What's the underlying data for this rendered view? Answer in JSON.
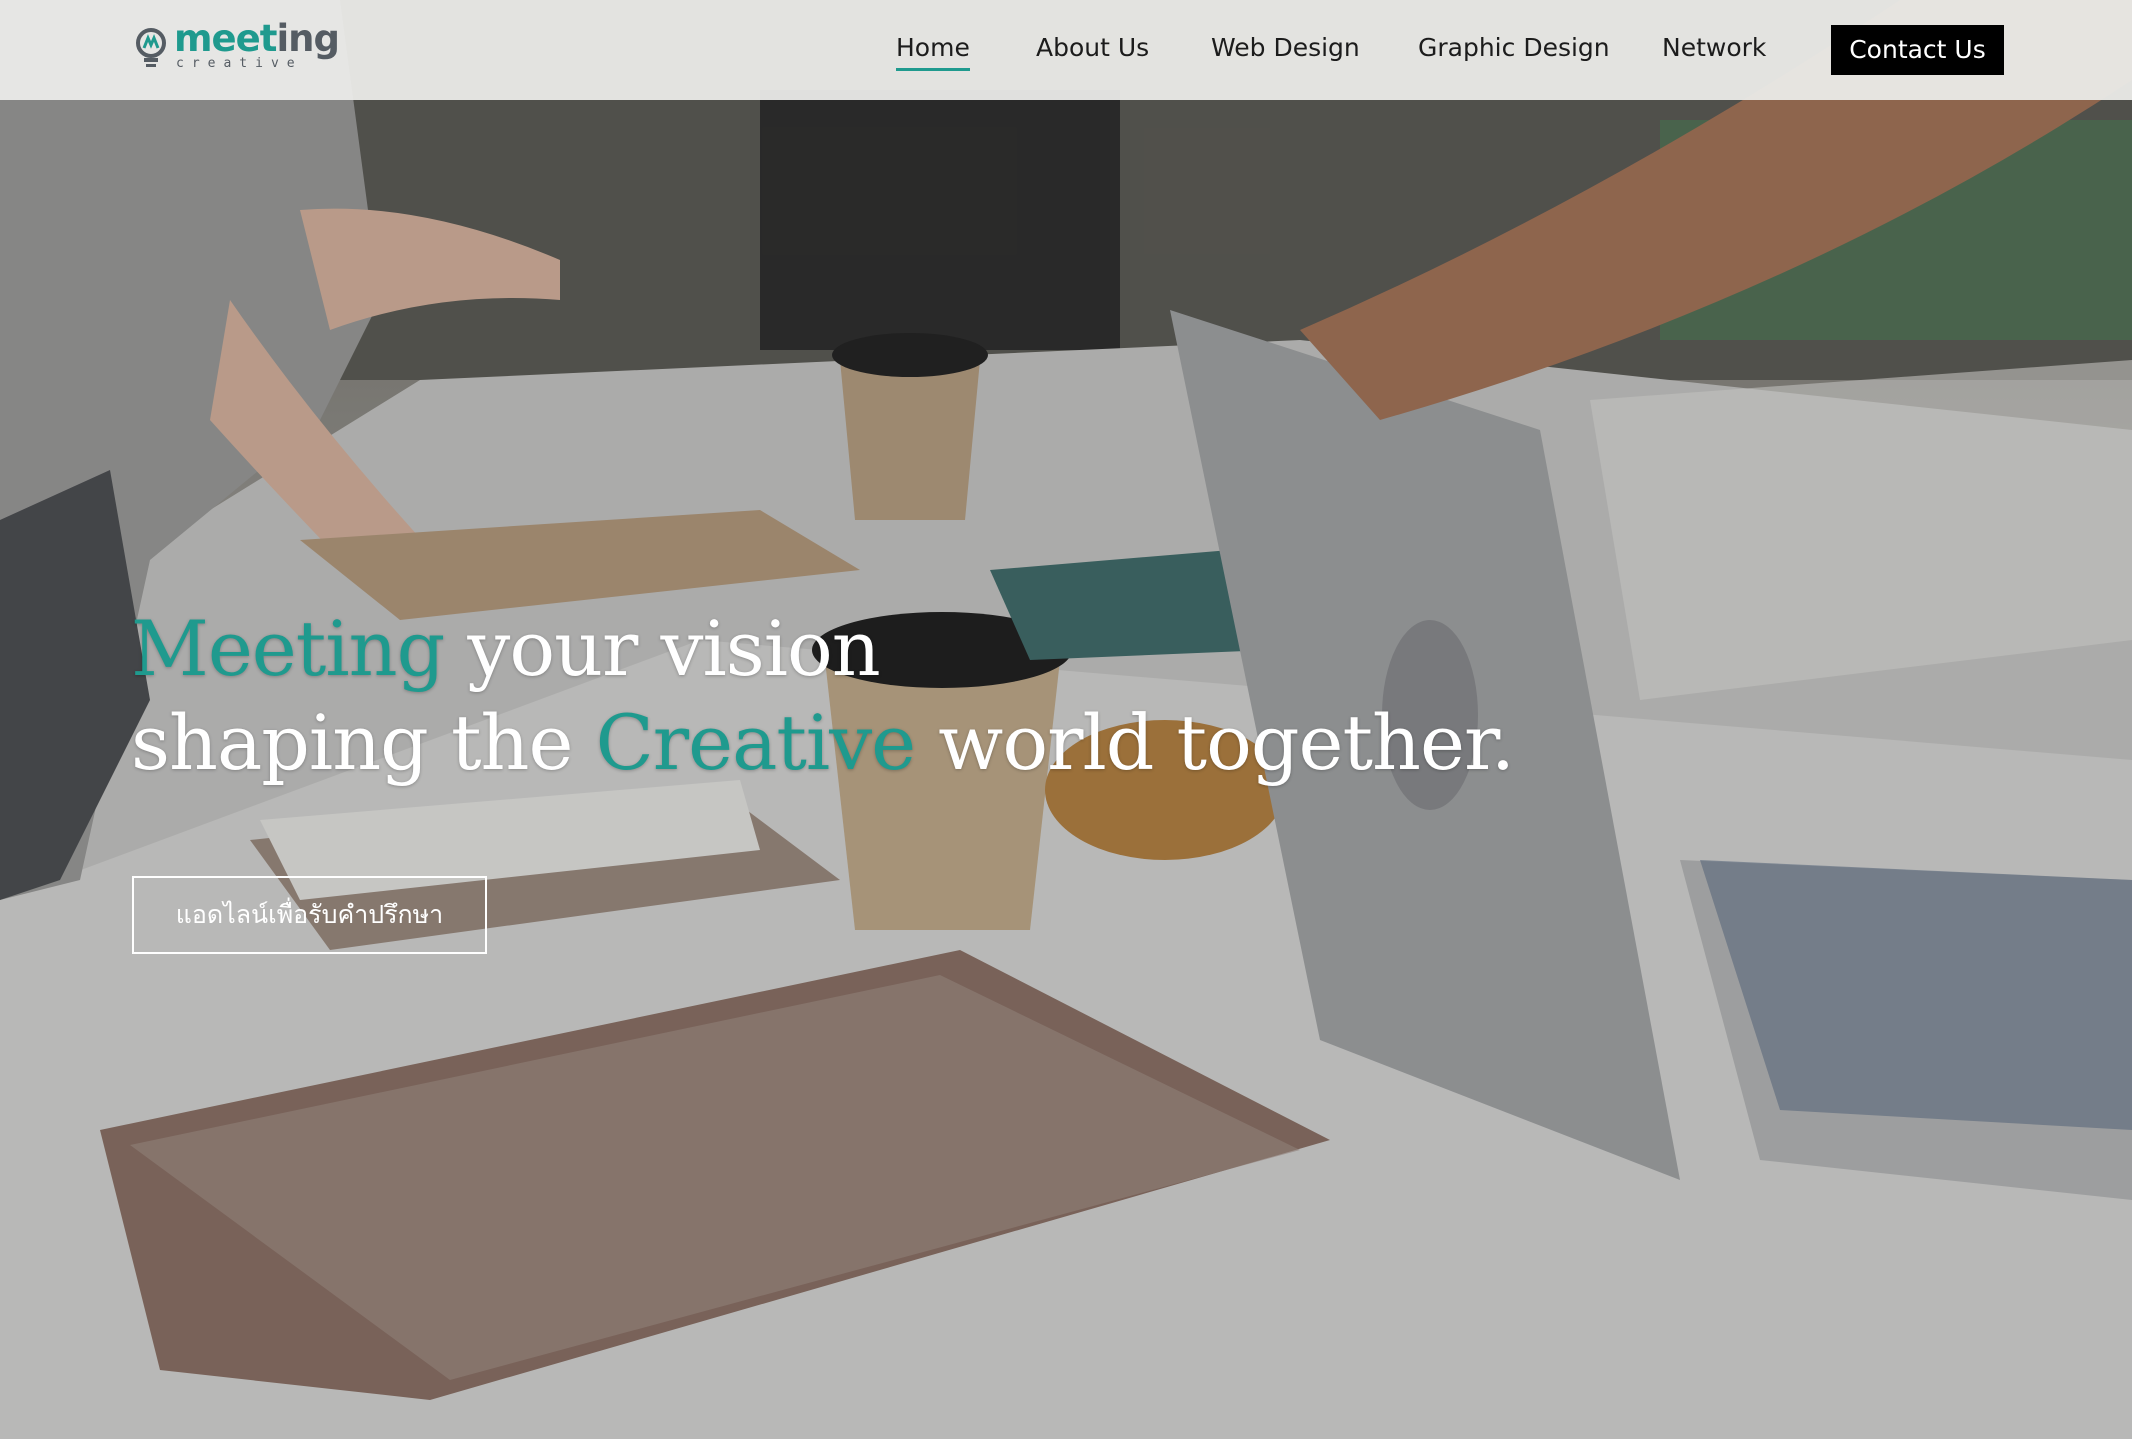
{
  "header": {
    "logo_main_accent": "meet",
    "logo_main_rest": "ing",
    "logo_sub": "creative",
    "nav": [
      {
        "label": "Home"
      },
      {
        "label": "About Us"
      },
      {
        "label": "Web Design"
      },
      {
        "label": "Graphic Design"
      },
      {
        "label": "Network"
      }
    ],
    "contact_label": "Contact Us"
  },
  "hero": {
    "line1_accent": "Meeting",
    "line1_rest": " your vision",
    "line2_start": "shaping the ",
    "line2_accent": "Creative",
    "line2_end": " world together.",
    "cta_label": "แอดไลน์เพื่อรับคำปรึกษา"
  },
  "colors": {
    "accent": "#1f9a8e",
    "logo_gray": "#555c63",
    "header_bg": "#ecece9",
    "contact_bg": "#000000"
  }
}
